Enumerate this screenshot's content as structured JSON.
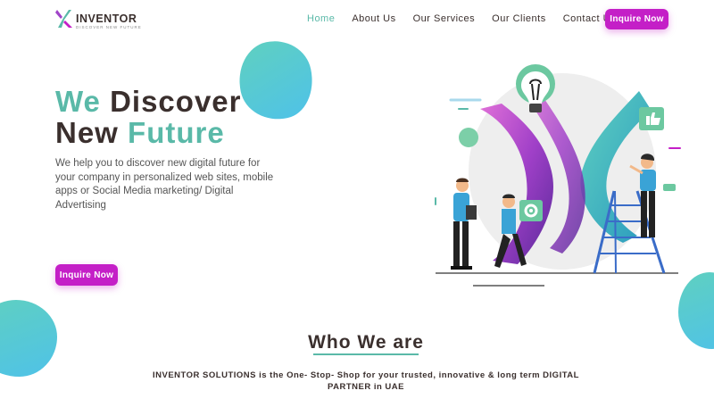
{
  "brand": {
    "name": "INVENTOR",
    "tagline": "DISCOVER NEW FUTURE",
    "colors": {
      "accent": "#5ab9a8",
      "cta": "#c41fc7",
      "dark": "#3a2f2d",
      "blob": "#4fc2e8"
    }
  },
  "nav": {
    "items": [
      {
        "label": "Home",
        "active": true
      },
      {
        "label": "About Us"
      },
      {
        "label": "Our Services"
      },
      {
        "label": "Our Clients"
      },
      {
        "label": "Contact Us"
      }
    ],
    "cta_label": "Inquire Now"
  },
  "hero": {
    "title_line1_accent": "We",
    "title_line1_rest": " Discover",
    "title_line2_rest": "New ",
    "title_line2_accent": "Future",
    "description": "We help you to discover new digital future for your company in personalized web sites, mobile apps or Social Media marketing/ Digital Advertising",
    "cta_label": "Inquire Now",
    "illustration_icons": [
      "lightbulb-icon",
      "thumbs-up-icon",
      "gear-icon"
    ]
  },
  "about": {
    "title": "Who We are",
    "description": "INVENTOR SOLUTIONS is the One- Stop- Shop for your trusted, innovative & long term  DIGITAL PARTNER in UAE"
  }
}
